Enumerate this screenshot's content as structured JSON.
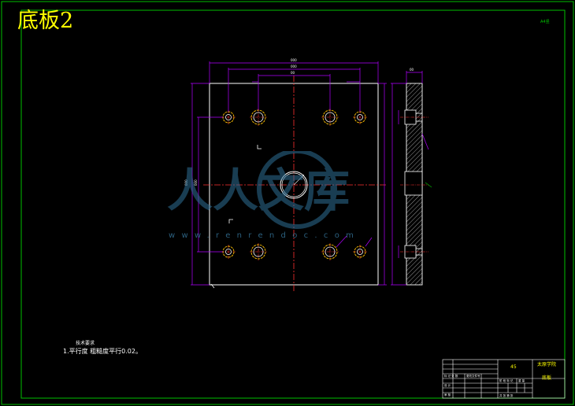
{
  "title": "底板2",
  "corner_label": "A4竖",
  "notes": {
    "heading": "技术要求",
    "item1": "1.平行度 粗糙度平行0.02。"
  },
  "title_block": {
    "material": "45",
    "school": "太原学院",
    "part_name": "底板"
  },
  "watermark": {
    "logo_text": "人人文库",
    "url": "www.renrendoc.com"
  },
  "colors": {
    "border": "#00c000",
    "part_outline": "#ffffff",
    "centerline": "#ff3030",
    "dimension": "#b000ff",
    "hole": "#ffc000",
    "hatch": "#ffffff",
    "title_text": "#ffff00"
  }
}
